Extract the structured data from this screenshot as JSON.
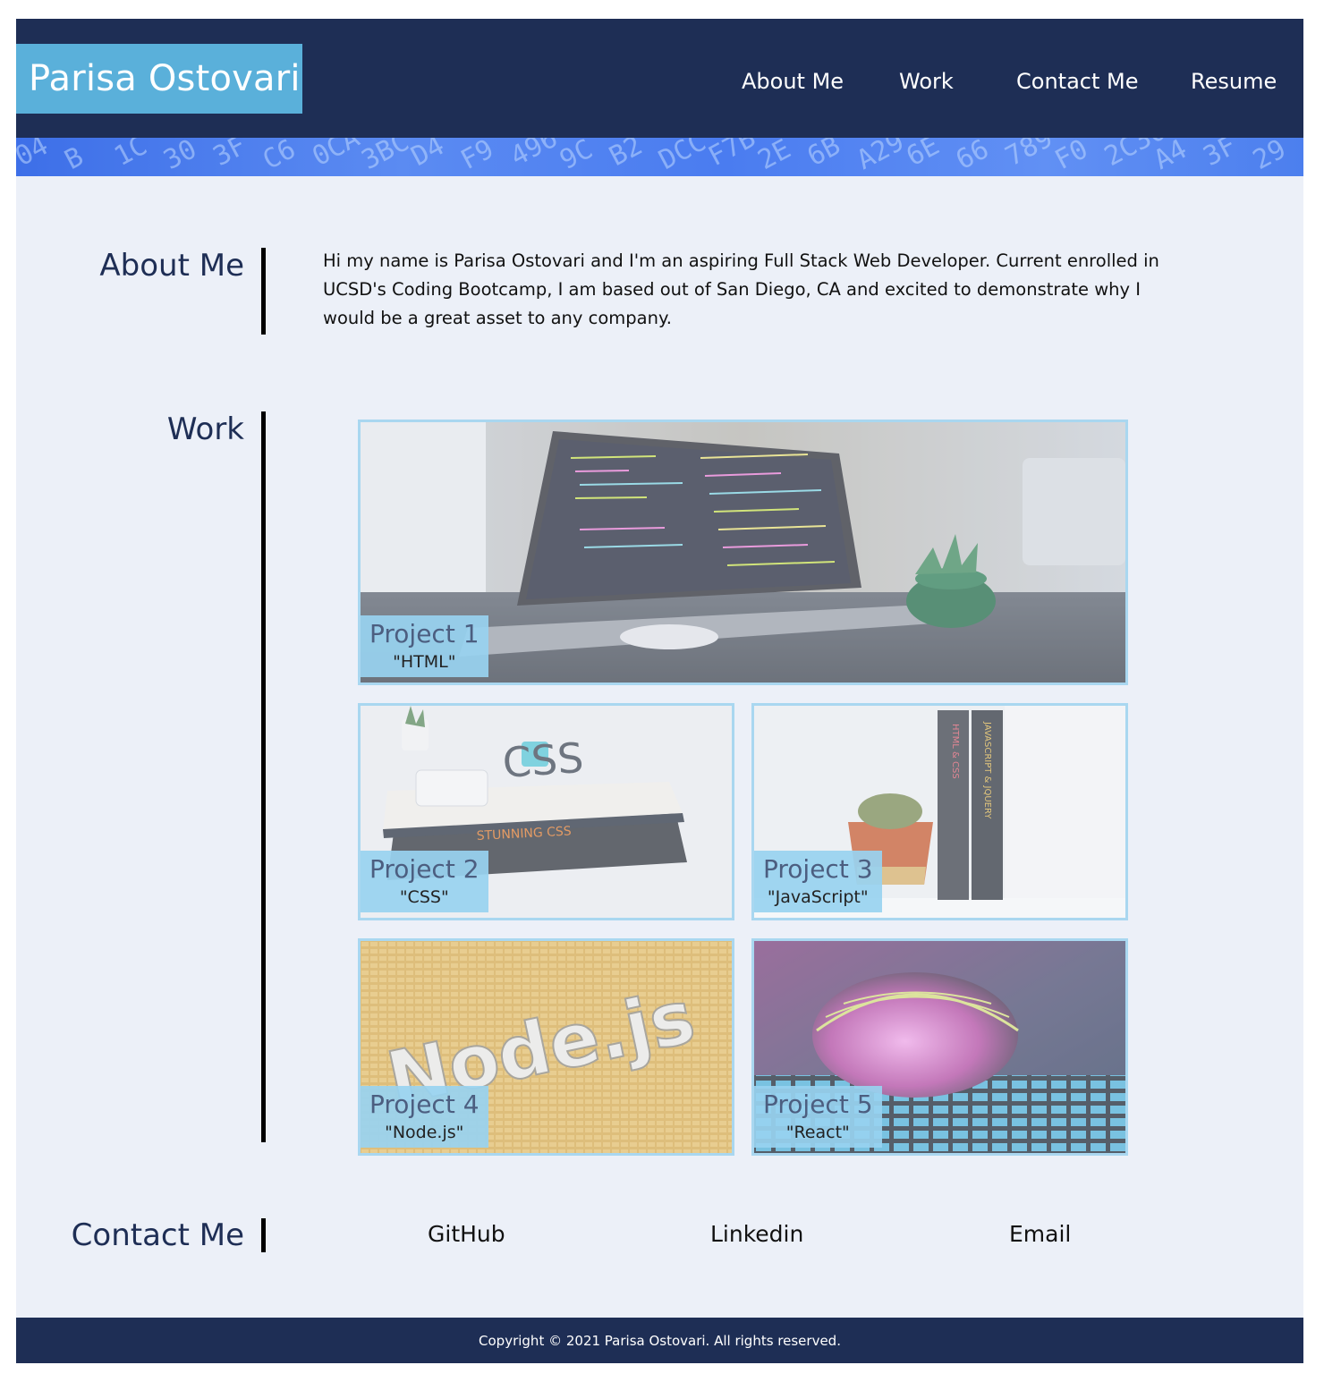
{
  "header": {
    "brand": "Parisa Ostovari",
    "nav": [
      {
        "label": "About Me"
      },
      {
        "label": "Work"
      },
      {
        "label": "Contact Me"
      },
      {
        "label": "Resume"
      }
    ],
    "banner_glyphs": [
      "04",
      "B",
      "1C",
      "30",
      "3F",
      "C6",
      "0CA",
      "3BC",
      "D4",
      "F9",
      "496",
      "9C",
      "B2",
      "DCC",
      "F7B",
      "2E",
      "6B",
      "A29",
      "6E",
      "66",
      "789",
      "F0",
      "2C30",
      "A4",
      "3F",
      "29"
    ]
  },
  "about": {
    "title": "About Me",
    "text": "Hi my name is Parisa Ostovari and I'm an aspiring Full Stack Web Developer. Current enrolled in UCSD's Coding Bootcamp, I am based out of San Diego, CA and excited to demonstrate why I would be a great asset to any company."
  },
  "work": {
    "title": "Work",
    "projects": [
      {
        "title": "Project 1",
        "subtitle": "\"HTML\"",
        "image": "laptop-code-photo"
      },
      {
        "title": "Project 2",
        "subtitle": "\"CSS\"",
        "image": "css-books-photo",
        "book_text": "CSS",
        "book_text2": "STUNNING CSS"
      },
      {
        "title": "Project 3",
        "subtitle": "\"JavaScript\"",
        "image": "js-books-cactus-photo",
        "book_text": "HTML & CSS",
        "book_text2": "JAVASCRIPT & JQUERY"
      },
      {
        "title": "Project 4",
        "subtitle": "\"Node.js\"",
        "image": "nodejs-3d-photo",
        "art_text": "Node.js"
      },
      {
        "title": "Project 5",
        "subtitle": "\"React\"",
        "image": "glass-sphere-photo"
      }
    ]
  },
  "contact": {
    "title": "Contact Me",
    "links": [
      {
        "label": "GitHub"
      },
      {
        "label": "Linkedin"
      },
      {
        "label": "Email"
      }
    ]
  },
  "footer": {
    "copyright": "Copyright © 2021 Parisa Ostovari. All rights reserved."
  },
  "colors": {
    "header_bg": "#1e2e55",
    "brand_bg": "#5ab0da",
    "page_bg": "#ecf0f8",
    "card_border": "#a9d7f0",
    "tag_bg": "#98d2f0"
  }
}
